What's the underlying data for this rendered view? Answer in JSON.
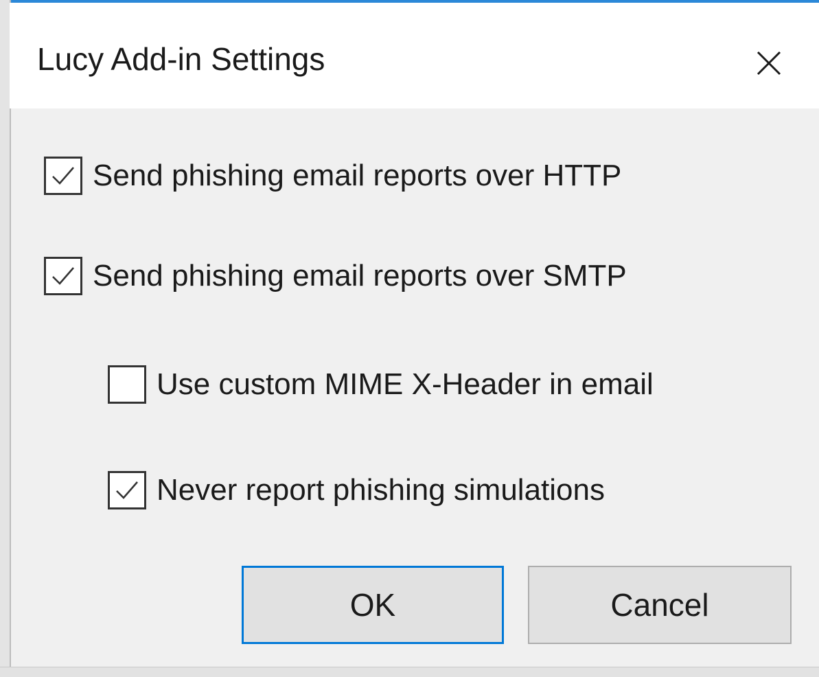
{
  "dialog": {
    "title": "Lucy Add-in Settings",
    "close_icon": "close-icon"
  },
  "options": [
    {
      "label": "Send phishing email reports over HTTP",
      "checked": true
    },
    {
      "label": "Send phishing email reports over SMTP",
      "checked": true
    },
    {
      "label": "Use custom MIME X-Header in email",
      "checked": false
    },
    {
      "label": "Never report phishing simulations",
      "checked": true
    }
  ],
  "buttons": {
    "ok_label": "OK",
    "cancel_label": "Cancel"
  },
  "colors": {
    "accent": "#0078d7",
    "dialog_bg": "#f0f0f0",
    "titlebar_bg": "#ffffff"
  }
}
